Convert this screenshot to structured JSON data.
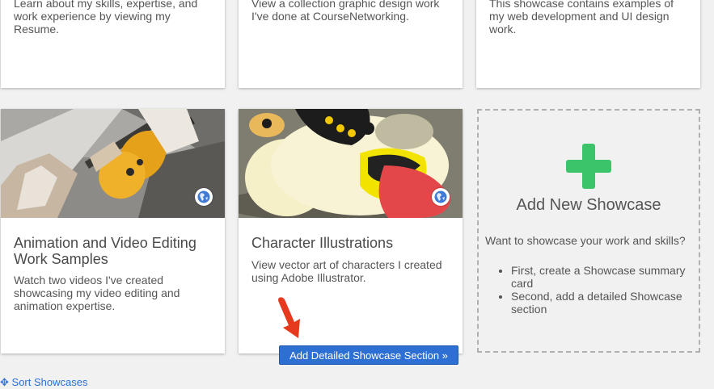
{
  "top_cards": [
    {
      "text": "Learn about my skills, expertise, and work experience by viewing my Resume."
    },
    {
      "text": "View a collection graphic design work I've done at CourseNetworking."
    },
    {
      "text": "This showcase contains examples of my web development and UI design work."
    }
  ],
  "cards": [
    {
      "title": "Animation and Video Editing Work Samples",
      "text": "Watch two videos I've created showcasing my video editing and animation expertise."
    },
    {
      "title": "Character Illustrations",
      "text": "View vector art of characters I created using Adobe Illustrator."
    }
  ],
  "add_showcase": {
    "title": "Add New Showcase",
    "subtitle": "Want to showcase your work and skills?",
    "steps": [
      "First, create a Showcase summary card",
      "Second, add a detailed Showcase section"
    ]
  },
  "cta": {
    "label": "Add Detailed Showcase Section »"
  },
  "sort": {
    "label": "Sort Showcases"
  },
  "colors": {
    "accent": "#2d6fd2",
    "plus_green": "#3cc46b",
    "arrow_red": "#e53a1e"
  }
}
